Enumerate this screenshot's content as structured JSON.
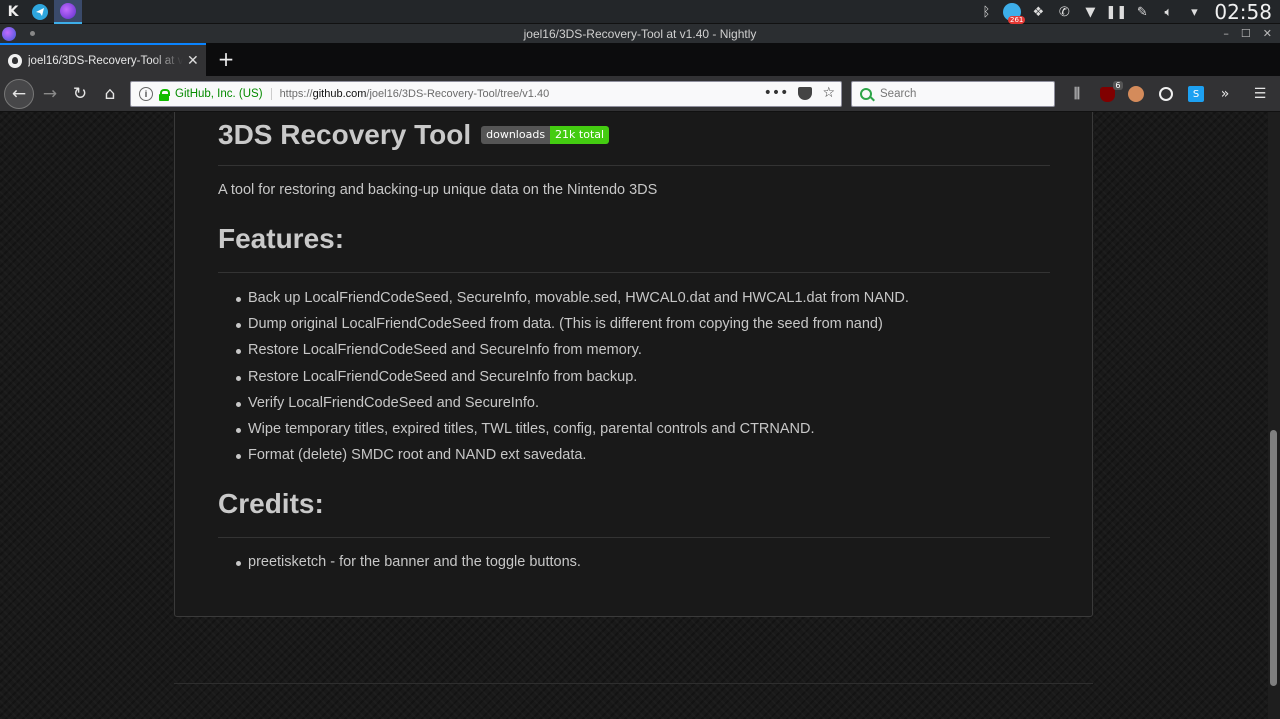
{
  "panel": {
    "launcher_glyph": "K",
    "clock": "02:58",
    "notification_count": "261"
  },
  "window": {
    "title": "joel16/3DS-Recovery-Tool at v1.40 - Nightly"
  },
  "tabs": [
    {
      "label": "joel16/3DS-Recovery-Tool at v1.40 - Nightly",
      "active": true
    }
  ],
  "navbar": {
    "site_identity": "GitHub, Inc. (US)",
    "url_prefix": "https://",
    "url_domain": "github.com",
    "url_path": "/joel16/3DS-Recovery-Tool/tree/v1.40",
    "search_placeholder": "Search",
    "ublock_count": "6"
  },
  "readme": {
    "title": "3DS Recovery Tool",
    "badge_label": "downloads",
    "badge_value": "21k total",
    "description": "A tool for restoring and backing-up unique data on the Nintendo 3DS",
    "features_heading": "Features:",
    "features": [
      "Back up LocalFriendCodeSeed, SecureInfo, movable.sed, HWCAL0.dat and HWCAL1.dat from NAND.",
      "Dump original LocalFriendCodeSeed from data. (This is different from copying the seed from nand)",
      "Restore LocalFriendCodeSeed and SecureInfo from memory.",
      "Restore LocalFriendCodeSeed and SecureInfo from backup.",
      "Verify LocalFriendCodeSeed and SecureInfo.",
      "Wipe temporary titles, expired titles, TWL titles, config, parental controls and CTRNAND.",
      "Format (delete) SMDC root and NAND ext savedata."
    ],
    "credits_heading": "Credits:",
    "credits": [
      "preetisketch - for the banner and the toggle buttons."
    ]
  },
  "colors": {
    "accent": "#0a84ff",
    "badge_value_bg": "#44cc11",
    "secure_green": "#12bc00"
  }
}
